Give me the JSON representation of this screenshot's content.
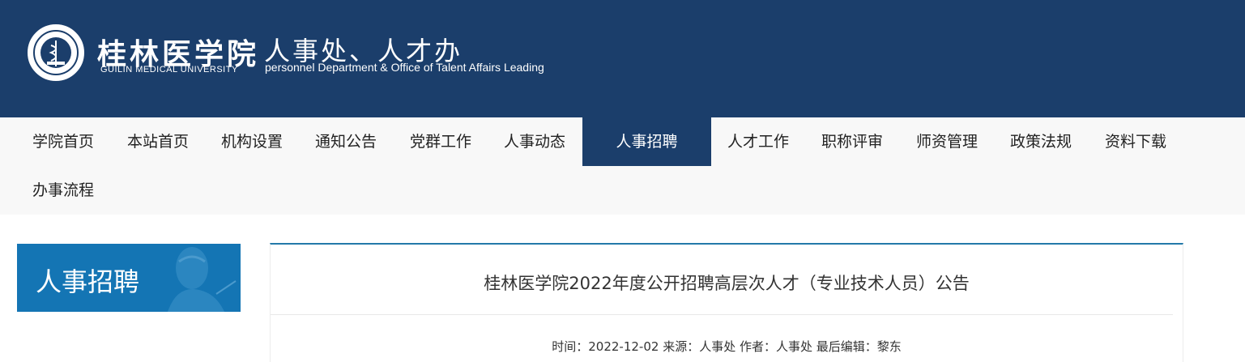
{
  "header": {
    "brand_cn": "桂林医学院",
    "brand_en": "GUILIN MEDICAL UNIVERSITY",
    "dept_cn": "人事处、人才办",
    "dept_en": "personnel Department & Office of Talent Affairs Leading",
    "background_color": "#1b3e6b"
  },
  "nav": {
    "items": [
      {
        "label": "学院首页"
      },
      {
        "label": "本站首页"
      },
      {
        "label": "机构设置"
      },
      {
        "label": "通知公告"
      },
      {
        "label": "党群工作"
      },
      {
        "label": "人事动态"
      },
      {
        "label": "人事招聘",
        "active": true
      },
      {
        "label": "人才工作"
      },
      {
        "label": "职称评审"
      },
      {
        "label": "师资管理"
      },
      {
        "label": "政策法规"
      },
      {
        "label": "资料下载"
      },
      {
        "label": "办事流程"
      }
    ],
    "active_color": "#1b3e6b"
  },
  "sidebar": {
    "title": "人事招聘",
    "background_color": "#1475b4"
  },
  "article": {
    "title": "桂林医学院2022年度公开招聘高层次人才（专业技术人员）公告",
    "meta": "时间：2022-12-02 来源：人事处 作者：人事处 最后编辑：黎东"
  }
}
